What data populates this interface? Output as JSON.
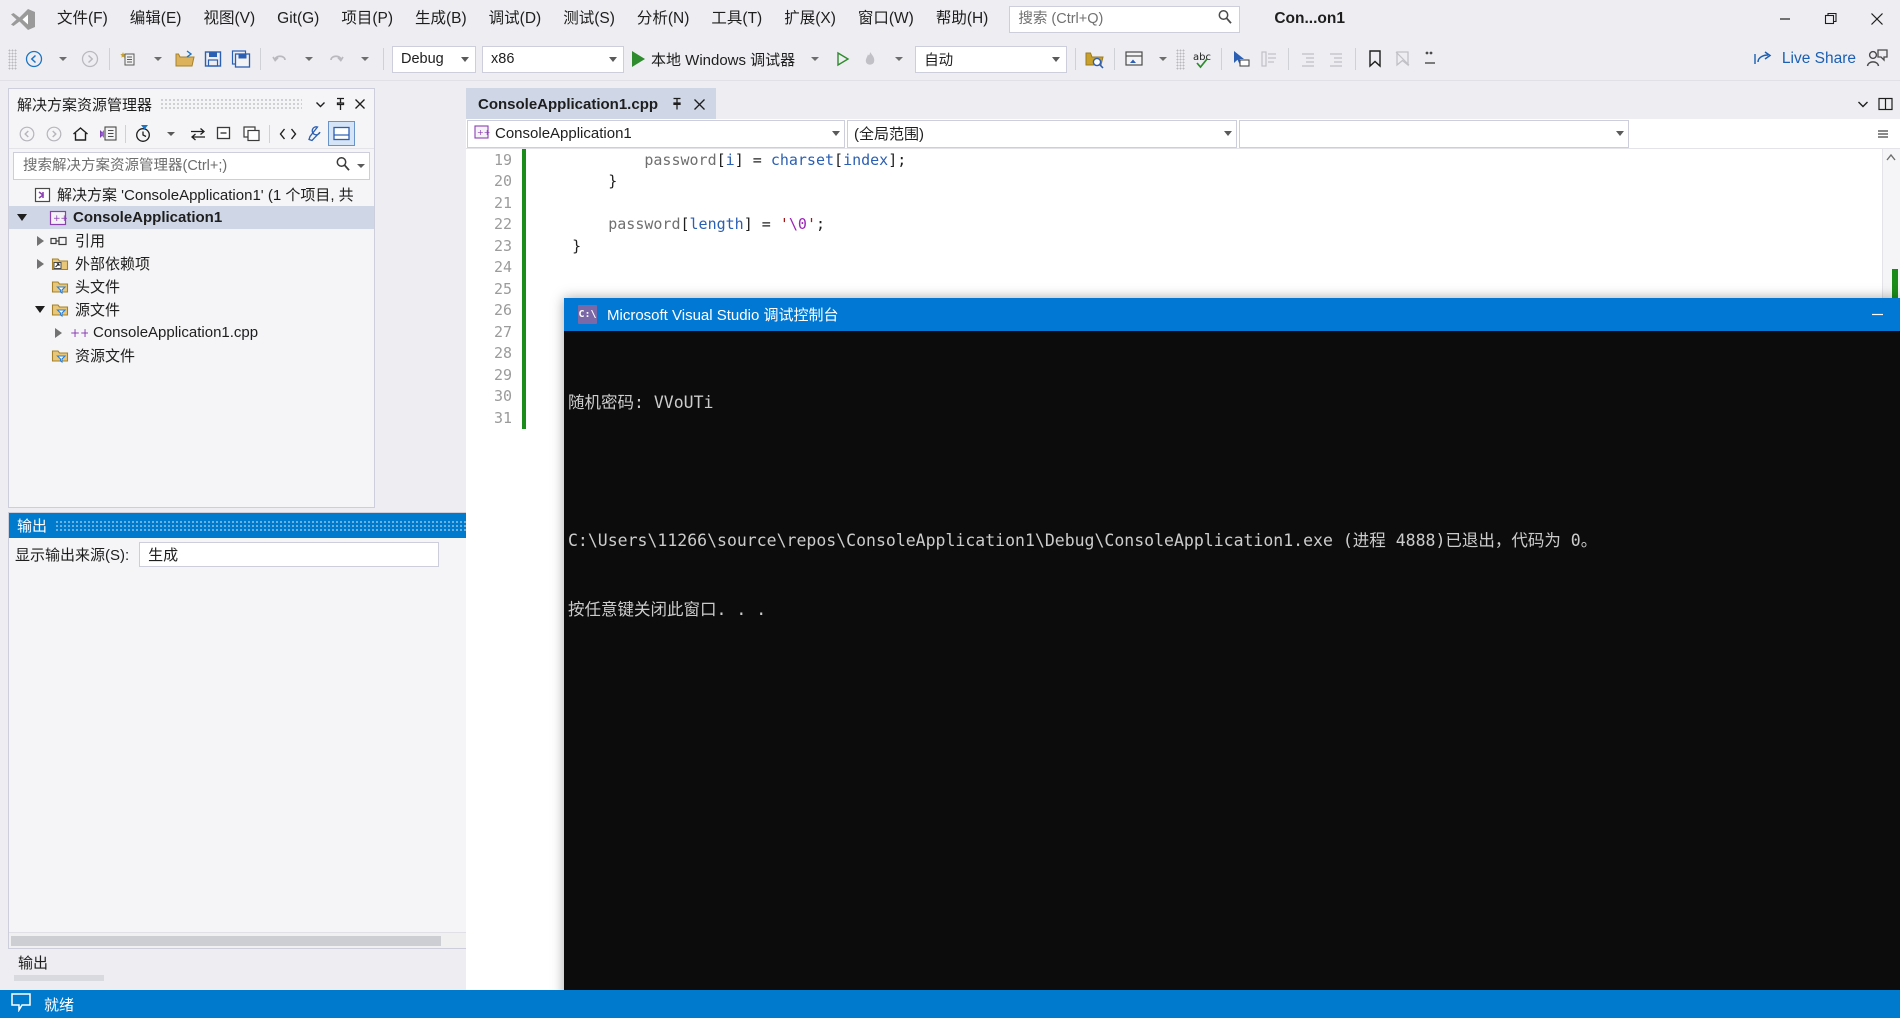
{
  "window": {
    "title": "Con...on1",
    "minimize": "—",
    "restore": "restore-icon",
    "close": "×"
  },
  "menu": {
    "items": [
      {
        "label": "文件(F)",
        "name": "menu-file"
      },
      {
        "label": "编辑(E)",
        "name": "menu-edit"
      },
      {
        "label": "视图(V)",
        "name": "menu-view"
      },
      {
        "label": "Git(G)",
        "name": "menu-git"
      },
      {
        "label": "项目(P)",
        "name": "menu-project"
      },
      {
        "label": "生成(B)",
        "name": "menu-build"
      },
      {
        "label": "调试(D)",
        "name": "menu-debug"
      },
      {
        "label": "测试(S)",
        "name": "menu-test"
      },
      {
        "label": "分析(N)",
        "name": "menu-analyze"
      },
      {
        "label": "工具(T)",
        "name": "menu-tools"
      },
      {
        "label": "扩展(X)",
        "name": "menu-extensions"
      },
      {
        "label": "窗口(W)",
        "name": "menu-window"
      },
      {
        "label": "帮助(H)",
        "name": "menu-help"
      }
    ]
  },
  "search": {
    "placeholder": "搜索 (Ctrl+Q)",
    "value": "",
    "icon": "search-icon"
  },
  "toolbar": {
    "config": "Debug",
    "platform": "x86",
    "run_label": "本地 Windows 调试器",
    "auto": "自动",
    "live_share": "Live Share"
  },
  "solution_explorer": {
    "title": "解决方案资源管理器",
    "search_placeholder": "搜索解决方案资源管理器(Ctrl+;)",
    "search_value": "",
    "tree": [
      {
        "label": "解决方案 'ConsoleApplication1' (1 个项目, 共",
        "indent": 0,
        "twisty": "none",
        "icon": "solution-icon",
        "selected": false,
        "name": "tree-item-solution"
      },
      {
        "label": "ConsoleApplication1",
        "indent": 1,
        "twisty": "down",
        "icon": "cpp-project-icon",
        "selected": true,
        "name": "tree-item-project"
      },
      {
        "label": "引用",
        "indent": 2,
        "twisty": "right",
        "icon": "references-icon",
        "selected": false,
        "name": "tree-item-references"
      },
      {
        "label": "外部依赖项",
        "indent": 2,
        "twisty": "right",
        "icon": "external-deps-icon",
        "selected": false,
        "name": "tree-item-external-dependencies"
      },
      {
        "label": "头文件",
        "indent": 2,
        "twisty": "none",
        "icon": "filter-folder-icon",
        "selected": false,
        "name": "tree-item-header-files"
      },
      {
        "label": "源文件",
        "indent": 2,
        "twisty": "down",
        "icon": "filter-folder-icon",
        "selected": false,
        "name": "tree-item-source-files"
      },
      {
        "label": "ConsoleApplication1.cpp",
        "indent": 3,
        "twisty": "right",
        "icon": "cpp-file-icon",
        "selected": false,
        "name": "tree-item-cpp-file"
      },
      {
        "label": "资源文件",
        "indent": 2,
        "twisty": "none",
        "icon": "filter-folder-icon",
        "selected": false,
        "name": "tree-item-resource-files"
      }
    ]
  },
  "output": {
    "title": "输出",
    "source_label": "显示输出来源(S):",
    "source_value": "生成",
    "tab_label": "输出"
  },
  "editor": {
    "tab_label": "ConsoleApplication1.cpp",
    "pin_icon": "pin-icon",
    "close_icon": "close-icon",
    "nav_project": "ConsoleApplication1",
    "nav_scope": "(全局范围)",
    "nav_member": "",
    "lines": [
      {
        "num": "19",
        "changed": true,
        "html": "            password[i] = charset[index];"
      },
      {
        "num": "20",
        "changed": true,
        "html": "        }"
      },
      {
        "num": "21",
        "changed": true,
        "html": ""
      },
      {
        "num": "22",
        "changed": true,
        "html": "        password[length] = '\\0';"
      },
      {
        "num": "23",
        "changed": true,
        "html": "    }"
      },
      {
        "num": "24",
        "changed": true,
        "html": ""
      },
      {
        "num": "25",
        "changed": true,
        "html": ""
      },
      {
        "num": "26",
        "changed": true,
        "html": ""
      },
      {
        "num": "27",
        "changed": true,
        "html": ""
      },
      {
        "num": "28",
        "changed": true,
        "html": ""
      },
      {
        "num": "29",
        "changed": true,
        "html": ""
      },
      {
        "num": "30",
        "changed": true,
        "html": ""
      },
      {
        "num": "31",
        "changed": true,
        "html": ""
      }
    ]
  },
  "console": {
    "title": "Microsoft Visual Studio 调试控制台",
    "icon_text": "C:\\",
    "minimize": "—",
    "lines": [
      "随机密码: VVoUTi",
      "",
      "C:\\Users\\11266\\source\\repos\\ConsoleApplication1\\Debug\\ConsoleApplication1.exe (进程 4888)已退出，代码为 0。",
      "按任意键关闭此窗口. . ."
    ]
  },
  "statusbar": {
    "text": "就绪",
    "icon": "ready-icon"
  },
  "colors": {
    "accent": "#007acc",
    "console_title": "#0078d4",
    "selection": "#cfd6e6",
    "tab_active": "#cfd6e6"
  }
}
